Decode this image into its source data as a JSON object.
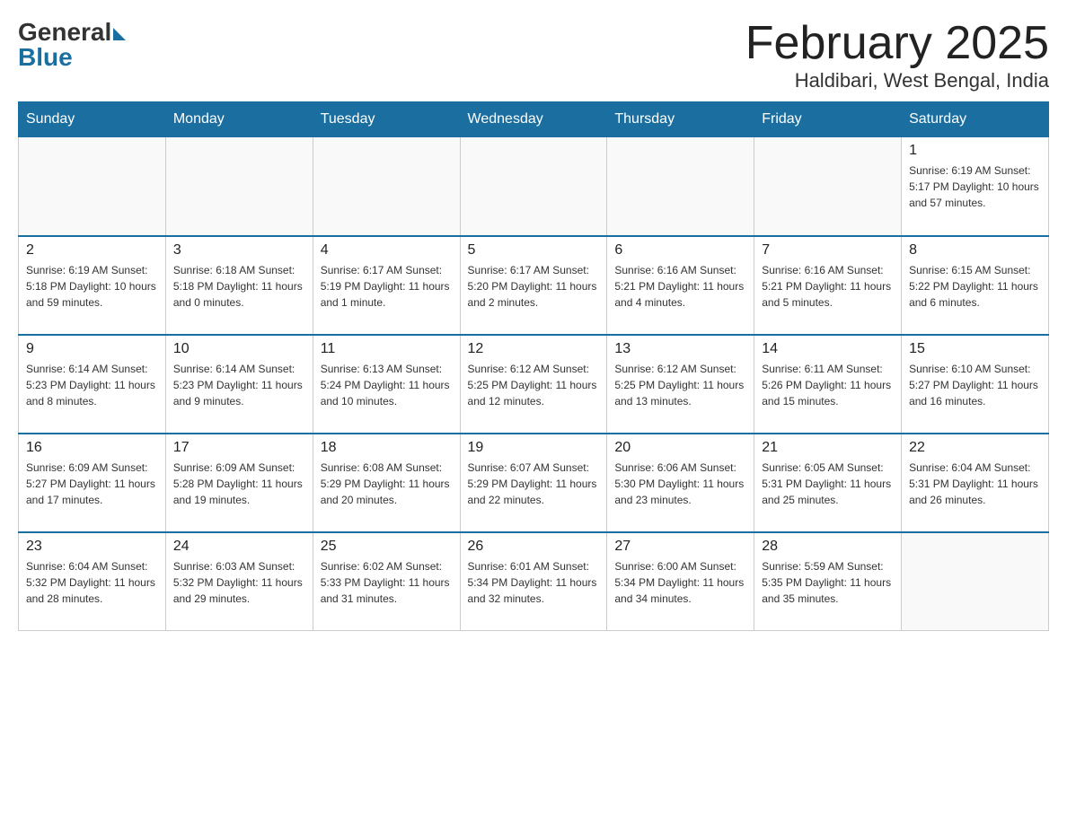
{
  "logo": {
    "general": "General",
    "blue": "Blue"
  },
  "title": "February 2025",
  "location": "Haldibari, West Bengal, India",
  "days_of_week": [
    "Sunday",
    "Monday",
    "Tuesday",
    "Wednesday",
    "Thursday",
    "Friday",
    "Saturday"
  ],
  "weeks": [
    [
      {
        "day": "",
        "info": ""
      },
      {
        "day": "",
        "info": ""
      },
      {
        "day": "",
        "info": ""
      },
      {
        "day": "",
        "info": ""
      },
      {
        "day": "",
        "info": ""
      },
      {
        "day": "",
        "info": ""
      },
      {
        "day": "1",
        "info": "Sunrise: 6:19 AM\nSunset: 5:17 PM\nDaylight: 10 hours and 57 minutes."
      }
    ],
    [
      {
        "day": "2",
        "info": "Sunrise: 6:19 AM\nSunset: 5:18 PM\nDaylight: 10 hours and 59 minutes."
      },
      {
        "day": "3",
        "info": "Sunrise: 6:18 AM\nSunset: 5:18 PM\nDaylight: 11 hours and 0 minutes."
      },
      {
        "day": "4",
        "info": "Sunrise: 6:17 AM\nSunset: 5:19 PM\nDaylight: 11 hours and 1 minute."
      },
      {
        "day": "5",
        "info": "Sunrise: 6:17 AM\nSunset: 5:20 PM\nDaylight: 11 hours and 2 minutes."
      },
      {
        "day": "6",
        "info": "Sunrise: 6:16 AM\nSunset: 5:21 PM\nDaylight: 11 hours and 4 minutes."
      },
      {
        "day": "7",
        "info": "Sunrise: 6:16 AM\nSunset: 5:21 PM\nDaylight: 11 hours and 5 minutes."
      },
      {
        "day": "8",
        "info": "Sunrise: 6:15 AM\nSunset: 5:22 PM\nDaylight: 11 hours and 6 minutes."
      }
    ],
    [
      {
        "day": "9",
        "info": "Sunrise: 6:14 AM\nSunset: 5:23 PM\nDaylight: 11 hours and 8 minutes."
      },
      {
        "day": "10",
        "info": "Sunrise: 6:14 AM\nSunset: 5:23 PM\nDaylight: 11 hours and 9 minutes."
      },
      {
        "day": "11",
        "info": "Sunrise: 6:13 AM\nSunset: 5:24 PM\nDaylight: 11 hours and 10 minutes."
      },
      {
        "day": "12",
        "info": "Sunrise: 6:12 AM\nSunset: 5:25 PM\nDaylight: 11 hours and 12 minutes."
      },
      {
        "day": "13",
        "info": "Sunrise: 6:12 AM\nSunset: 5:25 PM\nDaylight: 11 hours and 13 minutes."
      },
      {
        "day": "14",
        "info": "Sunrise: 6:11 AM\nSunset: 5:26 PM\nDaylight: 11 hours and 15 minutes."
      },
      {
        "day": "15",
        "info": "Sunrise: 6:10 AM\nSunset: 5:27 PM\nDaylight: 11 hours and 16 minutes."
      }
    ],
    [
      {
        "day": "16",
        "info": "Sunrise: 6:09 AM\nSunset: 5:27 PM\nDaylight: 11 hours and 17 minutes."
      },
      {
        "day": "17",
        "info": "Sunrise: 6:09 AM\nSunset: 5:28 PM\nDaylight: 11 hours and 19 minutes."
      },
      {
        "day": "18",
        "info": "Sunrise: 6:08 AM\nSunset: 5:29 PM\nDaylight: 11 hours and 20 minutes."
      },
      {
        "day": "19",
        "info": "Sunrise: 6:07 AM\nSunset: 5:29 PM\nDaylight: 11 hours and 22 minutes."
      },
      {
        "day": "20",
        "info": "Sunrise: 6:06 AM\nSunset: 5:30 PM\nDaylight: 11 hours and 23 minutes."
      },
      {
        "day": "21",
        "info": "Sunrise: 6:05 AM\nSunset: 5:31 PM\nDaylight: 11 hours and 25 minutes."
      },
      {
        "day": "22",
        "info": "Sunrise: 6:04 AM\nSunset: 5:31 PM\nDaylight: 11 hours and 26 minutes."
      }
    ],
    [
      {
        "day": "23",
        "info": "Sunrise: 6:04 AM\nSunset: 5:32 PM\nDaylight: 11 hours and 28 minutes."
      },
      {
        "day": "24",
        "info": "Sunrise: 6:03 AM\nSunset: 5:32 PM\nDaylight: 11 hours and 29 minutes."
      },
      {
        "day": "25",
        "info": "Sunrise: 6:02 AM\nSunset: 5:33 PM\nDaylight: 11 hours and 31 minutes."
      },
      {
        "day": "26",
        "info": "Sunrise: 6:01 AM\nSunset: 5:34 PM\nDaylight: 11 hours and 32 minutes."
      },
      {
        "day": "27",
        "info": "Sunrise: 6:00 AM\nSunset: 5:34 PM\nDaylight: 11 hours and 34 minutes."
      },
      {
        "day": "28",
        "info": "Sunrise: 5:59 AM\nSunset: 5:35 PM\nDaylight: 11 hours and 35 minutes."
      },
      {
        "day": "",
        "info": ""
      }
    ]
  ]
}
